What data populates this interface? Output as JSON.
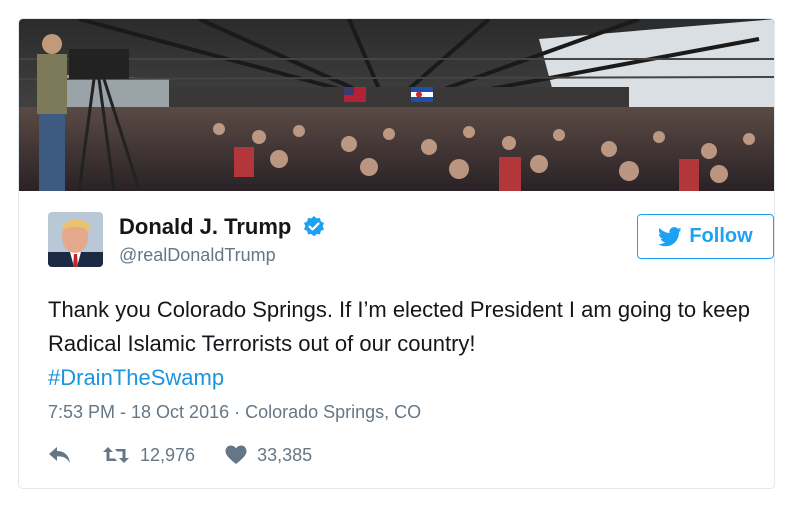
{
  "tweet": {
    "display_name": "Donald J. Trump",
    "handle": "@realDonaldTrump",
    "verified_icon": "verified-badge-icon",
    "follow_label": "Follow",
    "text": "Thank you Colorado Springs. If I’m elected President I am going to keep Radical Islamic Terrorists out of our country!",
    "hashtag": "#DrainTheSwamp",
    "meta": "7:53 PM - 18 Oct 2016 · Colorado Springs, CO",
    "retweets": "12,976",
    "likes": "33,385"
  },
  "icons": {
    "reply": "reply-icon",
    "retweet": "retweet-icon",
    "like": "heart-icon",
    "bird": "twitter-bird-icon"
  },
  "colors": {
    "accent": "#1da1f2",
    "hashtag": "#1b95e0",
    "secondary_text": "#657786",
    "border": "#e1e8ed"
  }
}
